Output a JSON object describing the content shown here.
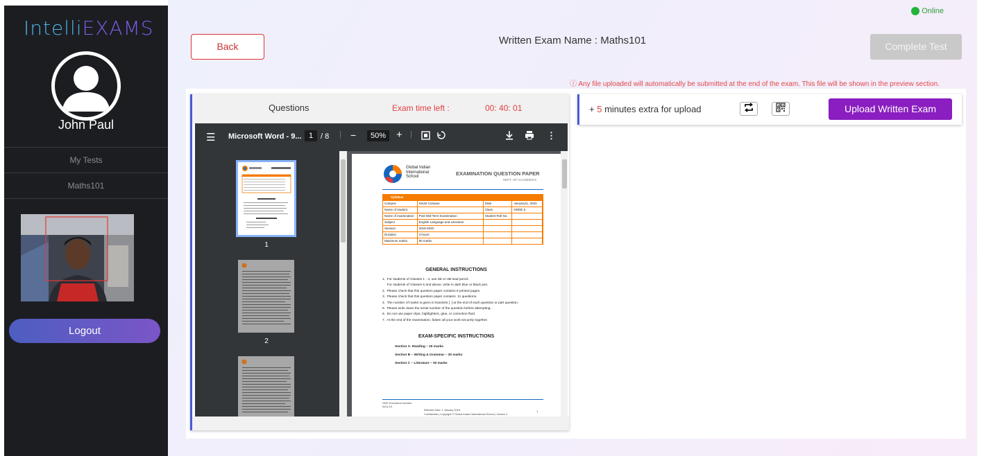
{
  "sidebar": {
    "logo_part1": "Intelli",
    "logo_part2": "EXAMS",
    "user_name": "John Paul",
    "nav": [
      "My Tests",
      "Maths101"
    ],
    "logout_label": "Logout"
  },
  "header": {
    "status": "Online",
    "back_label": "Back",
    "exam_title": "Written Exam Name : Maths101",
    "complete_label": "Complete Test",
    "notice": "ⓘ Any file uploaded will automatically be submitted at the end of the exam. This file will be shown in the preview section."
  },
  "questions": {
    "label": "Questions",
    "time_label": "Exam time left :",
    "time_value": "00: 40: 01"
  },
  "pdf": {
    "file_name": "Microsoft Word - 9...",
    "page": "1",
    "page_total": "/ 8",
    "zoom": "50%",
    "thumbs": [
      "1",
      "2"
    ],
    "doc": {
      "school": "Global Indian International School",
      "heading": "EXAMINATION QUESTION PAPER",
      "dept": "DEPT. OF ACADEMICS",
      "table_title": "Syllabus",
      "rows": [
        [
          "Campus",
          "Smart Campus",
          "Date",
          "January11, 2020"
        ],
        [
          "Name of student",
          "",
          "Class",
          "GRDE 6"
        ],
        [
          "Name of examination",
          "Post Mid-Term Examination",
          "Student Roll No.",
          ""
        ],
        [
          "Subject",
          "English Language and Literature",
          "",
          ""
        ],
        [
          "Session",
          "2019-2020",
          "",
          ""
        ],
        [
          "Duration",
          "3 hours",
          "",
          ""
        ],
        [
          "Maximum marks",
          "80 marks",
          "",
          ""
        ]
      ],
      "gen_title": "GENERAL INSTRUCTIONS",
      "gen": [
        "1.  For students of Classes 1 - 4, use 2B or HB lead pencil.",
        "     For students of Classes 5 and above, write in dark blue or black pen.",
        "2.  Please check that this question paper contains 8 printed pages.",
        "3.  Please check that this question paper contains  11 questions.",
        "4.  The number of marks is given in brackets [  ] at the end of each question or part question.",
        "5.  Please write down the serial number of the question before attempting.",
        "6.  Do not use paper clips, highlighters, glue, or correction fluid.",
        "7.  At the end of the examination, fasten all your work securely together."
      ],
      "spec_title": "EXAM-SPECIFIC INSTRUCTIONS",
      "spec": [
        "Section A- Reading – 20 marks",
        "Section B – Writing & Grammar – 30 marks",
        "Section C – Literature  – 30 marks"
      ],
      "footer1": "GEE Document number",
      "footer2": "ACA-10",
      "footer3": "Effective Date: 1 January 2018",
      "footer4": "Confidential  |  Copyright © Global Indian International School  |  Version 2",
      "footer_page": "1"
    }
  },
  "upload": {
    "extra_prefix": "+ ",
    "extra_num": "5",
    "extra_suffix": " minutes extra for upload",
    "upload_label": "Upload Written Exam"
  },
  "colors": {
    "accent": "#4a5ad6",
    "upload": "#8a1ec0",
    "alert": "#e04040",
    "online": "#22b33a"
  }
}
